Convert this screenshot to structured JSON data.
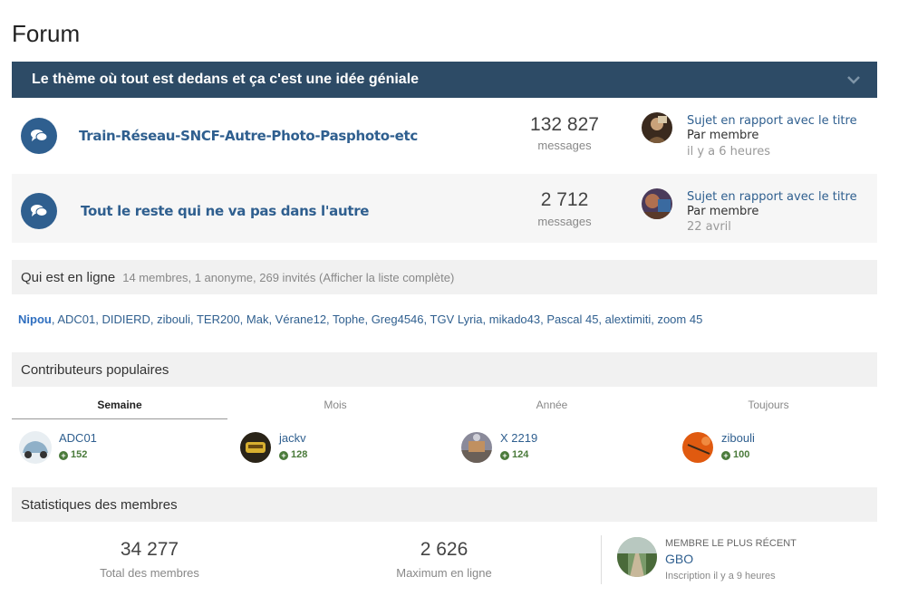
{
  "page": {
    "title": "Forum"
  },
  "category": {
    "title": "Le thème où tout est dedans  et ça c'est une idée géniale",
    "accent": "#2d4b66"
  },
  "forums": [
    {
      "title": "Train-Réseau-SNCF-Autre-Photo-Pasphoto-etc",
      "count": "132 827",
      "count_label": "messages",
      "last_title": "Sujet en rapport avec le titre",
      "last_by": "Par membre",
      "last_time": "il y a 6 heures"
    },
    {
      "title": "Tout le reste qui ne va pas dans l'autre",
      "count": "2 712",
      "count_label": "messages",
      "last_title": "Sujet en rapport avec le titre",
      "last_by": "Par membre",
      "last_time": "22 avril"
    }
  ],
  "online": {
    "title": "Qui est en ligne",
    "summary": "14 membres, 1 anonyme, 269 invités (Afficher la liste complète)",
    "first": "Nipou",
    "rest": ", ADC01, DIDIERD, zibouli, TER200, Mak, Vérane12, Tophe, Greg4546, TGV Lyria, mikado43, Pascal 45, alextimiti, zoom 45"
  },
  "contributors": {
    "title": "Contributeurs populaires",
    "tabs": [
      "Semaine",
      "Mois",
      "Année",
      "Toujours"
    ],
    "active_tab": "Semaine",
    "people": [
      {
        "name": "ADC01",
        "score": "152"
      },
      {
        "name": "jackv",
        "score": "128"
      },
      {
        "name": "X 2219",
        "score": "124"
      },
      {
        "name": "zibouli",
        "score": "100"
      }
    ]
  },
  "stats": {
    "title": "Statistiques des membres",
    "total": "34 277",
    "total_label": "Total des membres",
    "max": "2 626",
    "max_label": "Maximum en ligne",
    "newest_label": "MEMBRE LE PLUS RÉCENT",
    "newest_name": "GBO",
    "newest_sub": "Inscription il y a 9 heures"
  }
}
